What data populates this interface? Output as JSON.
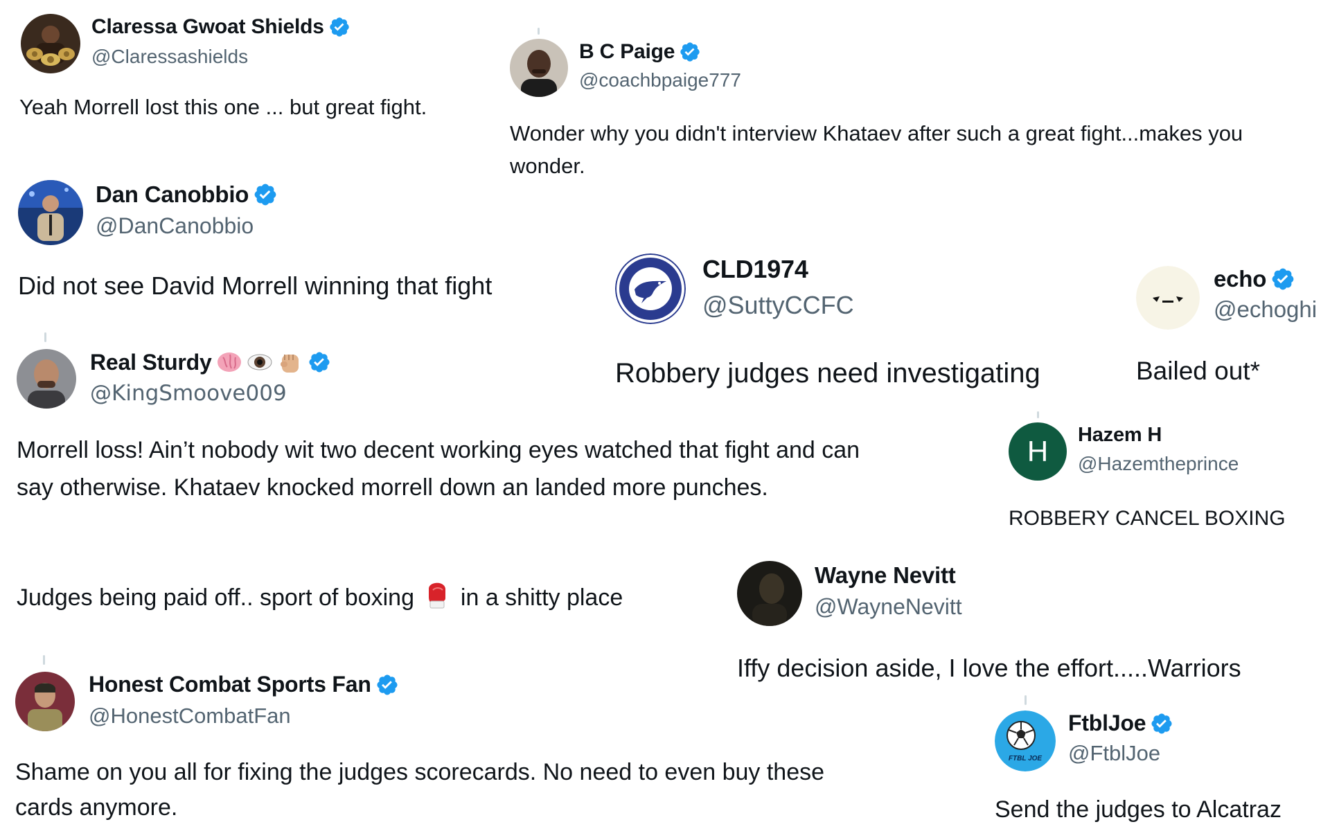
{
  "colors": {
    "verified_blue": "#1d9bf0",
    "handle_gray": "#536471",
    "text_dark": "#0f1419",
    "thread_line": "#cfd9de",
    "hazem_avatar_bg": "#0f5a40"
  },
  "tweets": [
    {
      "id": "claressa",
      "name": "Claressa Gwoat Shields",
      "handle": "@Claressashields",
      "verified": true,
      "avatar_icon": "boxer-belts-photo-avatar",
      "body": "Yeah Morrell lost this one ... but great fight."
    },
    {
      "id": "bcpaige",
      "name": "B C Paige",
      "handle": "@coachbpaige777",
      "verified": true,
      "avatar_icon": "man-portrait-avatar",
      "body": "Wonder why you didn't interview Khataev after such a great fight...makes you wonder."
    },
    {
      "id": "dancanobbio",
      "name": "Dan Canobbio",
      "handle": "@DanCanobbio",
      "verified": true,
      "avatar_icon": "broadcaster-photo-avatar",
      "body": "Did not see David Morrell winning that fight"
    },
    {
      "id": "cld1974",
      "name": "CLD1974",
      "handle": "@SuttyCCFC",
      "verified": false,
      "avatar_icon": "bluebird-crest-avatar",
      "avatar_text": "CARDIFF CITY FOOTBALL CLUB",
      "body": "Robbery judges need investigating"
    },
    {
      "id": "echo",
      "name": "echo",
      "handle": "@echoghi",
      "verified": true,
      "avatar_icon": "sleepy-face-avatar",
      "body": "Bailed out*"
    },
    {
      "id": "realsturdy",
      "name": "Real Sturdy",
      "name_emojis": [
        "brain-emoji",
        "eye-emoji",
        "raised-fist-emoji"
      ],
      "handle": "@KingSmoove009",
      "verified": true,
      "avatar_icon": "man-portrait-avatar",
      "body_para1": "Morrell loss!  Ain’t nobody wit two decent working eyes watched that fight and can say otherwise.  Khataev knocked morrell down an landed more punches.",
      "body_para2_before": "Judges being paid off.. sport of boxing",
      "body_para2_emoji": "boxing-glove-emoji",
      "body_para2_after": "in a shitty place"
    },
    {
      "id": "hazem",
      "name": "Hazem H",
      "handle": "@Hazemtheprince",
      "verified": false,
      "avatar_letter": "H",
      "body": "ROBBERY CANCEL BOXING"
    },
    {
      "id": "waynenevitt",
      "name": "Wayne Nevitt",
      "handle": "@WayneNevitt",
      "verified": false,
      "avatar_icon": "dark-photo-avatar",
      "body": "Iffy decision aside, I love the effort.....Warriors"
    },
    {
      "id": "honestcombat",
      "name": "Honest Combat Sports Fan",
      "handle": "@HonestCombatFan",
      "verified": true,
      "avatar_icon": "fighter-portrait-avatar",
      "body": "Shame on you all for fixing the judges scorecards. No need to even buy these cards anymore."
    },
    {
      "id": "ftbljoe",
      "name": "FtblJoe",
      "handle": "@FtblJoe",
      "verified": true,
      "avatar_icon": "soccer-ball-logo-avatar",
      "avatar_text": "FTBL JOE",
      "body": "Send the judges to Alcatraz"
    }
  ]
}
